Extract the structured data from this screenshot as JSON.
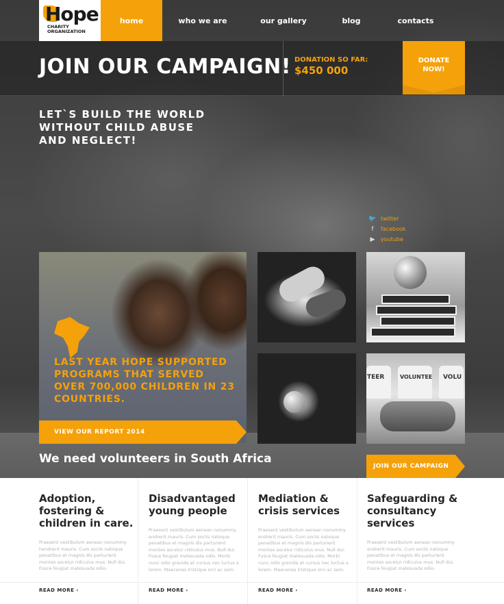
{
  "brand": {
    "name": "Hope",
    "tagline": "CHARITY ORGANIZATION"
  },
  "nav": {
    "items": [
      {
        "label": "home",
        "active": true
      },
      {
        "label": "who we are"
      },
      {
        "label": "our gallery"
      },
      {
        "label": "blog"
      },
      {
        "label": "contacts"
      }
    ]
  },
  "campaign": {
    "title": "JOIN OUR CAMPAIGN!",
    "donation_label": "DONATION SO FAR:",
    "donation_amount": "$450 000",
    "donate_button": "DONATE NOW!"
  },
  "slogan": "LET`S BUILD THE WORLD WITHOUT CHILD ABUSE AND NEGLECT!",
  "social": [
    {
      "icon": "twitter-icon",
      "glyph": "🐦",
      "label": "twitter"
    },
    {
      "icon": "facebook-icon",
      "glyph": "f",
      "label": "facebook"
    },
    {
      "icon": "youtube-icon",
      "glyph": "▶",
      "label": "youtube"
    }
  ],
  "feature": {
    "text": "LAST YEAR HOPE SUPPORTED PROGRAMS THAT SERVED OVER 700,000 CHILDREN IN 23 COUNTRIES.",
    "button": "VIEW OUR REPORT 2014"
  },
  "gallery": {
    "volunteer_shirt_1": "TEER",
    "volunteer_shirt_2": "VOLUNTEE",
    "volunteer_shirt_3": "VOLU"
  },
  "volunteers": {
    "text": "We need volunteers in South Africa",
    "button": "JOIN OUR CAMPAIGN"
  },
  "services": [
    {
      "title": "Adoption, fostering & children in care.",
      "body": "Praesent vestibulum aenean nonummy hendrerit mauris. Cum sociis natoque penatibus et magnis dis parturient montes ascetur ridiculus mus. Null dui. Fusce feugiat malesuada odio.",
      "more": "READ MORE ›"
    },
    {
      "title": "Disadvantaged young people",
      "body": "Praesent vestibulum aenean nonummy endrerit mauris. Cum sociis natoque penatibus et magnis dis parturient montes ascetur ridiculus mus. Null dui. Fusce feugiat malesuada odio. Morbi nunc odio gravida at cursus nec luctus a lorem. Maecenas tristique orci ac sem.",
      "more": "READ MORE ›"
    },
    {
      "title": "Mediation & crisis services",
      "body": "Praesent vestibulum aenean nonummy endrerit mauris. Cum sociis natoque penatibus et magnis dis parturient montes ascetur ridiculus mus. Null dui. Fusce feugiat malesuada odio. Morbi nunc odio gravida at cursus nec luctus a lorem. Maecenas tristique orci ac sem.",
      "more": "READ MORE ›"
    },
    {
      "title": "Safeguarding & consultancy services",
      "body": "Praesent vestibulum aenean nonummy endrerit mauris. Cum sociis natoque penatibus et magnis dis parturient montes ascetur ridiculus mus. Null dui. Fusce feugiat malesuada odio.",
      "more": "READ MORE ›"
    }
  ],
  "colors": {
    "accent": "#f5a10a",
    "dark": "#262626",
    "muted_text": "#b3b3b3"
  }
}
